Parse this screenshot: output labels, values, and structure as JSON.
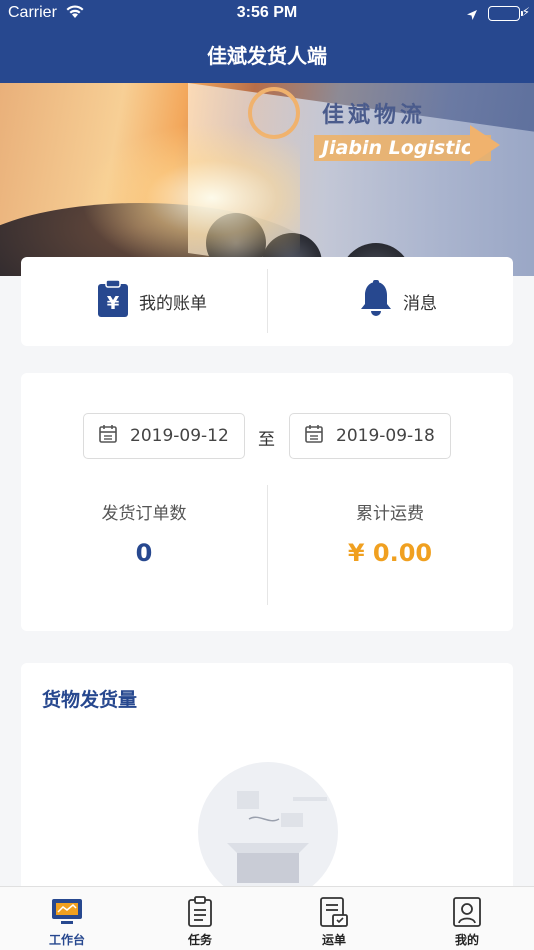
{
  "status_bar": {
    "carrier": "Carrier",
    "time": "3:56 PM"
  },
  "nav": {
    "title": "佳斌发货人端"
  },
  "banner": {
    "brand_cn": "佳斌物流",
    "brand_en": "Jiabin Logistics"
  },
  "quick_actions": {
    "bill_label": "我的账单",
    "message_label": "消息"
  },
  "stats": {
    "start_date": "2019-09-12",
    "separator": "至",
    "end_date": "2019-09-18",
    "orders_label": "发货订单数",
    "orders_value": "0",
    "freight_label": "累计运费",
    "freight_value": "¥ 0.00"
  },
  "chart_section": {
    "title": "货物发货量"
  },
  "tabbar": {
    "tabs": [
      {
        "label": "工作台",
        "icon": "workbench-icon"
      },
      {
        "label": "任务",
        "icon": "clipboard-icon"
      },
      {
        "label": "运单",
        "icon": "waybill-icon"
      },
      {
        "label": "我的",
        "icon": "profile-icon"
      }
    ]
  },
  "colors": {
    "primary": "#27488f",
    "accent": "#f0a020"
  }
}
